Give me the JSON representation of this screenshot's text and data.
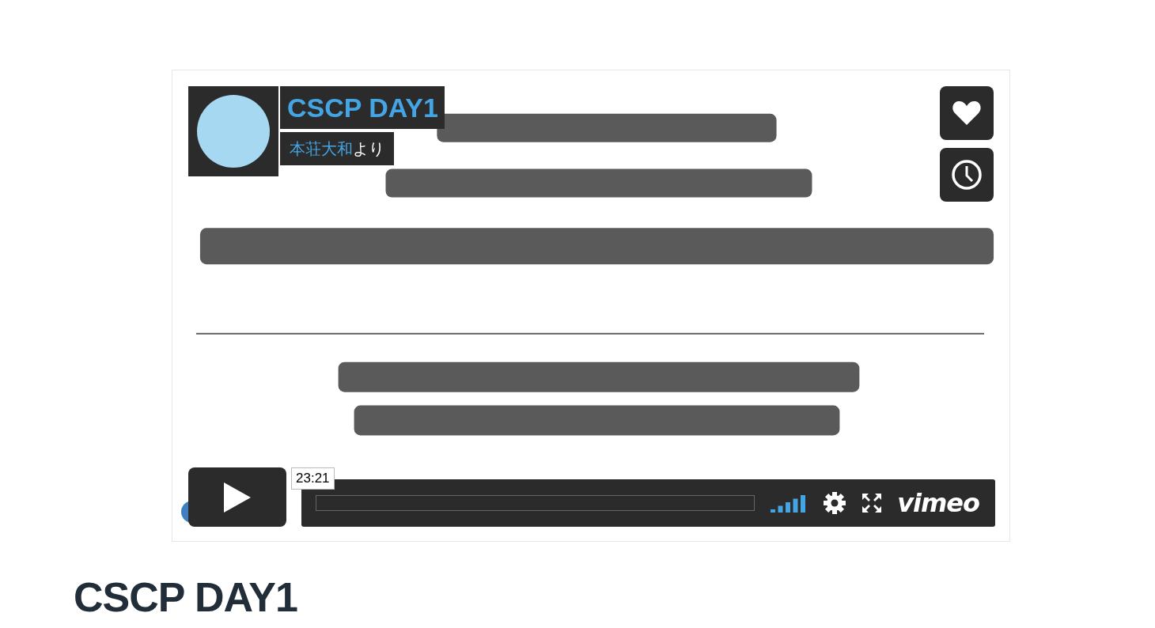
{
  "video": {
    "kind": "picture",
    "title": "CSCP DAY1",
    "byline": {
      "author": "本荘大和",
      "suffix": "より"
    },
    "time": "23:21",
    "progress": {
      "level": 0
    },
    "brand": "vimeo"
  },
  "heading": "CSCP DAY1"
}
